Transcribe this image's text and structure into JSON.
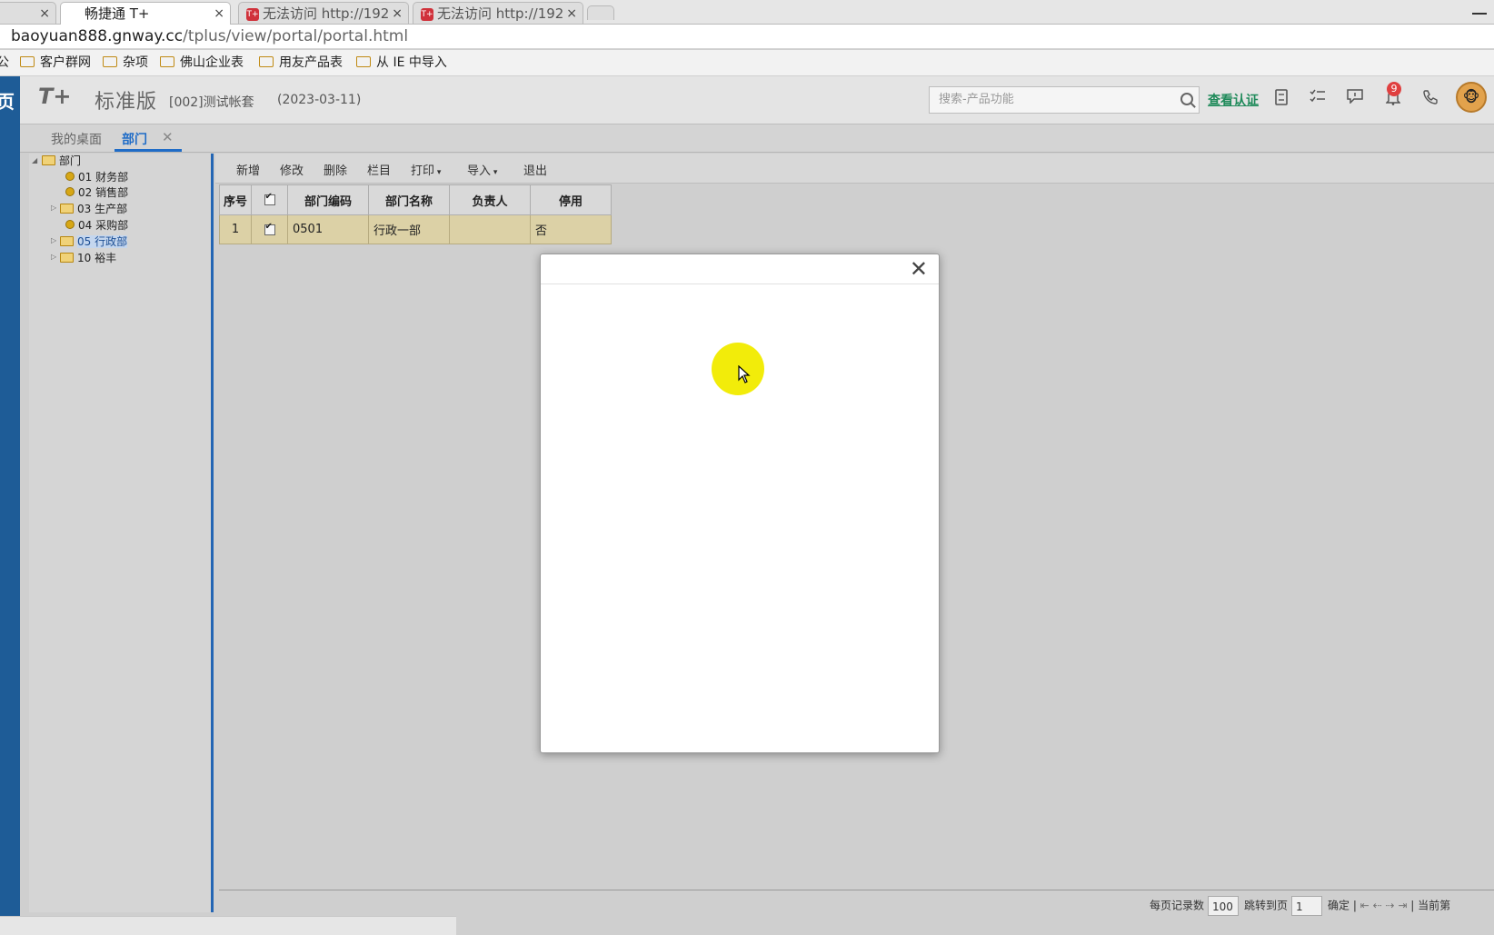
{
  "browser": {
    "tabs": [
      {
        "label": "",
        "close": "×"
      },
      {
        "label": "畅捷通 T+",
        "close": "×"
      },
      {
        "label": "无法访问 http://192",
        "close": "×",
        "favicon": "T+"
      },
      {
        "label": "无法访问 http://192",
        "close": "×",
        "favicon": "T+"
      }
    ],
    "address": {
      "host": "baoyuan888.gnway.cc",
      "path": "/tplus/view/portal/portal.html"
    },
    "bookmarks": [
      "客户群网",
      "杂项",
      "佛山企业表",
      "用友产品表",
      "从 IE 中导入"
    ],
    "bookmark_partial": "公"
  },
  "app": {
    "left_strip_text": "页",
    "logo": "T+",
    "edition": "标准版",
    "company": "[002]测试帐套",
    "date": "(2023-03-11)",
    "search_placeholder": "搜索-产品功能",
    "cert_link": "查看认证",
    "notification_count": "9",
    "icons": [
      "calculator-icon",
      "task-list-icon",
      "message-icon",
      "bell-icon",
      "phone-icon",
      "avatar"
    ]
  },
  "page_tabs": [
    {
      "label": "我的桌面",
      "active": false
    },
    {
      "label": "部门",
      "active": true,
      "close": "✕"
    }
  ],
  "tree": {
    "root": "部门",
    "nodes": [
      {
        "label": "01 财务部",
        "type": "leaf"
      },
      {
        "label": "02 销售部",
        "type": "leaf"
      },
      {
        "label": "03 生产部",
        "type": "folder"
      },
      {
        "label": "04 采购部",
        "type": "leaf"
      },
      {
        "label": "05 行政部",
        "type": "folder",
        "selected": true
      },
      {
        "label": "10 裕丰",
        "type": "folder"
      }
    ]
  },
  "toolbar": {
    "new": "新增",
    "edit": "修改",
    "delete": "删除",
    "columns": "栏目",
    "print": "打印",
    "import": "导入",
    "exit": "退出"
  },
  "grid": {
    "headers": [
      "序号",
      "",
      "部门编码",
      "部门名称",
      "负责人",
      "停用"
    ],
    "rows": [
      {
        "index": "1",
        "checked": true,
        "code": "0501",
        "name": "行政一部",
        "manager": "",
        "disabled": "否"
      }
    ]
  },
  "pager": {
    "per_page_label": "每页记录数",
    "per_page_value": "100",
    "jump_label": "跳转到页",
    "jump_value": "1",
    "confirm": "确定",
    "current_page_partial": "当前第"
  },
  "dialog": {
    "close": "✕"
  }
}
